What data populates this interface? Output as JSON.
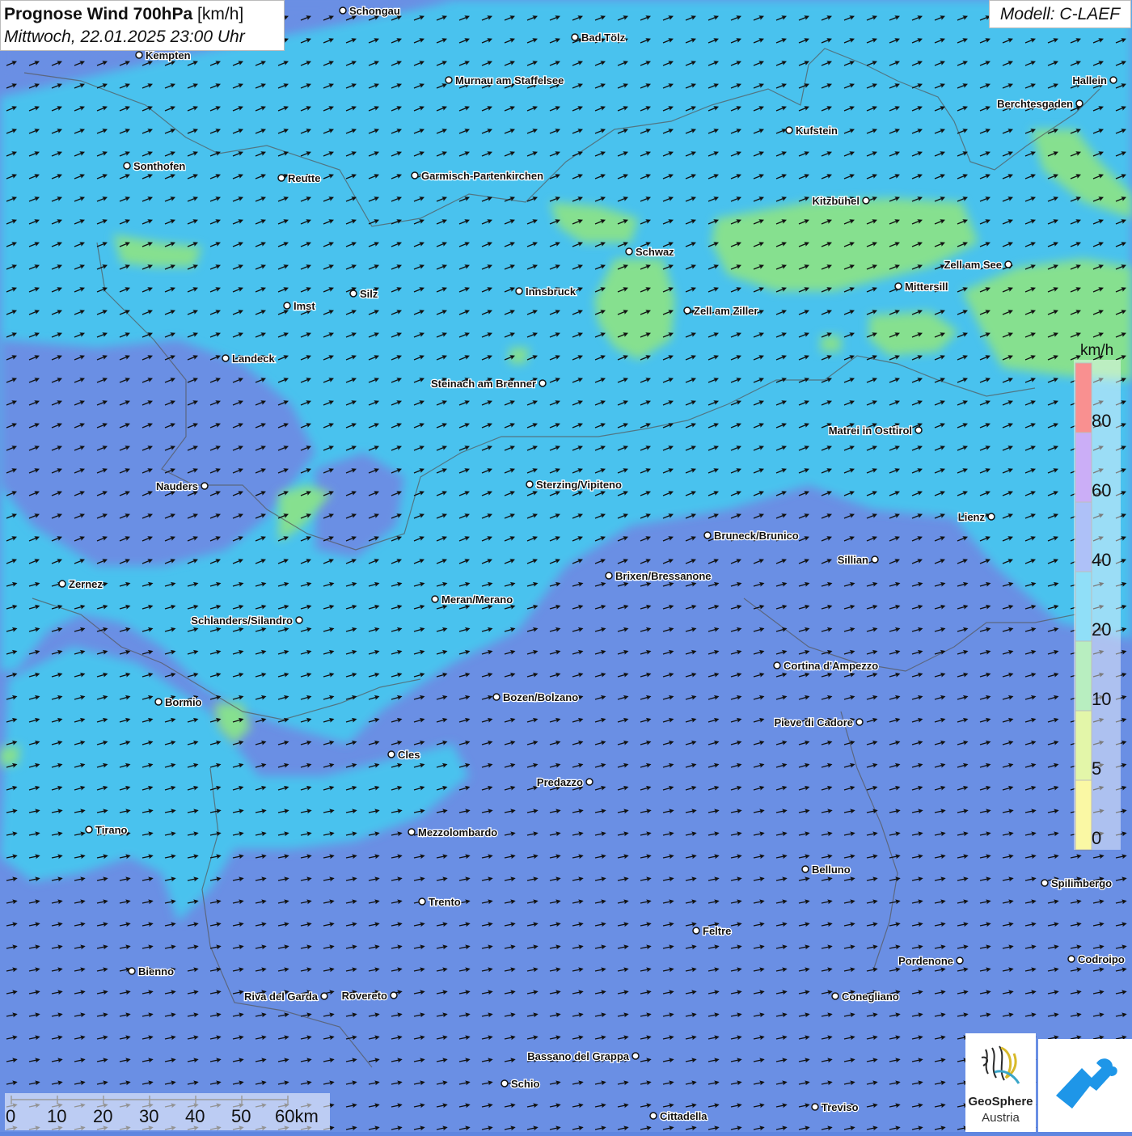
{
  "title": {
    "main_bold": "Prognose Wind 700hPa",
    "unit": "[km/h]",
    "datetime": "Mittwoch, 22.01.2025 23:00 Uhr"
  },
  "model": "Modell: C-LAEF",
  "legend": {
    "unit": "km/h",
    "labels": [
      "80",
      "60",
      "40",
      "20",
      "10",
      "5",
      "0"
    ],
    "colors": {
      "gt80": "#f43535",
      "60_80": "#a06cf0",
      "40_60": "#6c8ff2",
      "20_40": "#36c5f3",
      "10_20": "#7fe08c",
      "5_10": "#cdee63",
      "0_5": "#f6f35a"
    }
  },
  "scale_bar": {
    "labels": [
      "0",
      "10",
      "20",
      "30",
      "40",
      "50",
      "60km"
    ]
  },
  "logo": {
    "line1": "GeoSphere",
    "line2": "Austria"
  },
  "cities": [
    {
      "name": "Schongau",
      "lon": 424,
      "lat": 13
    },
    {
      "name": "Bad Tölz",
      "lon": 711,
      "lat": 46
    },
    {
      "name": "Kempten",
      "lon": 172,
      "lat": 68
    },
    {
      "name": "Murnau am Staffelsee",
      "lon": 555,
      "lat": 99
    },
    {
      "name": "Hallein",
      "lon": 1377,
      "lat": 99
    },
    {
      "name": "Berchtesgaden",
      "lon": 1335,
      "lat": 128
    },
    {
      "name": "Kufstein",
      "lon": 976,
      "lat": 161
    },
    {
      "name": "Sonthofen",
      "lon": 157,
      "lat": 205
    },
    {
      "name": "Reutte",
      "lon": 348,
      "lat": 220
    },
    {
      "name": "Garmisch-Partenkirchen",
      "lon": 513,
      "lat": 217
    },
    {
      "name": "Kitzbühel",
      "lon": 1071,
      "lat": 248
    },
    {
      "name": "Schwaz",
      "lon": 778,
      "lat": 311
    },
    {
      "name": "Zell am See",
      "lon": 1247,
      "lat": 327
    },
    {
      "name": "Mittersill",
      "lon": 1111,
      "lat": 354
    },
    {
      "name": "Innsbruck",
      "lon": 642,
      "lat": 360
    },
    {
      "name": "Silz",
      "lon": 437,
      "lat": 363
    },
    {
      "name": "Imst",
      "lon": 355,
      "lat": 378
    },
    {
      "name": "Zell am Ziller",
      "lon": 850,
      "lat": 384
    },
    {
      "name": "Landeck",
      "lon": 279,
      "lat": 443
    },
    {
      "name": "Steinach am Brenner",
      "lon": 671,
      "lat": 474
    },
    {
      "name": "Matrei in Osttirol",
      "lon": 1136,
      "lat": 532
    },
    {
      "name": "Nauders",
      "lon": 253,
      "lat": 601
    },
    {
      "name": "Sterzing/Vipiteno",
      "lon": 655,
      "lat": 599
    },
    {
      "name": "Lienz",
      "lon": 1226,
      "lat": 639
    },
    {
      "name": "Bruneck/Brunico",
      "lon": 875,
      "lat": 662
    },
    {
      "name": "Sillian",
      "lon": 1082,
      "lat": 692
    },
    {
      "name": "Brixen/Bressanone",
      "lon": 753,
      "lat": 712
    },
    {
      "name": "Zernez",
      "lon": 77,
      "lat": 722
    },
    {
      "name": "Meran/Merano",
      "lon": 538,
      "lat": 741
    },
    {
      "name": "Schlanders/Silandro",
      "lon": 370,
      "lat": 767
    },
    {
      "name": "Cortina d'Ampezzo",
      "lon": 961,
      "lat": 823
    },
    {
      "name": "Bozen/Bolzano",
      "lon": 614,
      "lat": 862
    },
    {
      "name": "Bormio",
      "lon": 196,
      "lat": 868
    },
    {
      "name": "Pieve di Cadore",
      "lon": 1063,
      "lat": 893
    },
    {
      "name": "Cles",
      "lon": 484,
      "lat": 933
    },
    {
      "name": "Predazzo",
      "lon": 729,
      "lat": 967
    },
    {
      "name": "Tirano",
      "lon": 110,
      "lat": 1026
    },
    {
      "name": "Mezzolombardo",
      "lon": 509,
      "lat": 1029
    },
    {
      "name": "Belluno",
      "lon": 996,
      "lat": 1075
    },
    {
      "name": "Spilimbergo",
      "lon": 1292,
      "lat": 1092
    },
    {
      "name": "Trento",
      "lon": 522,
      "lat": 1115
    },
    {
      "name": "Feltre",
      "lon": 861,
      "lat": 1151
    },
    {
      "name": "Pordenone",
      "lon": 1187,
      "lat": 1188
    },
    {
      "name": "Codroipo",
      "lon": 1325,
      "lat": 1186
    },
    {
      "name": "Bienno",
      "lon": 163,
      "lat": 1201
    },
    {
      "name": "Riva del Garda",
      "lon": 401,
      "lat": 1232
    },
    {
      "name": "Rovereto",
      "lon": 487,
      "lat": 1231
    },
    {
      "name": "Conegliano",
      "lon": 1033,
      "lat": 1232
    },
    {
      "name": "Bassano del Grappa",
      "lon": 786,
      "lat": 1306
    },
    {
      "name": "Schio",
      "lon": 624,
      "lat": 1340
    },
    {
      "name": "Treviso",
      "lon": 1008,
      "lat": 1369
    },
    {
      "name": "Cittadella",
      "lon": 808,
      "lat": 1380
    }
  ]
}
